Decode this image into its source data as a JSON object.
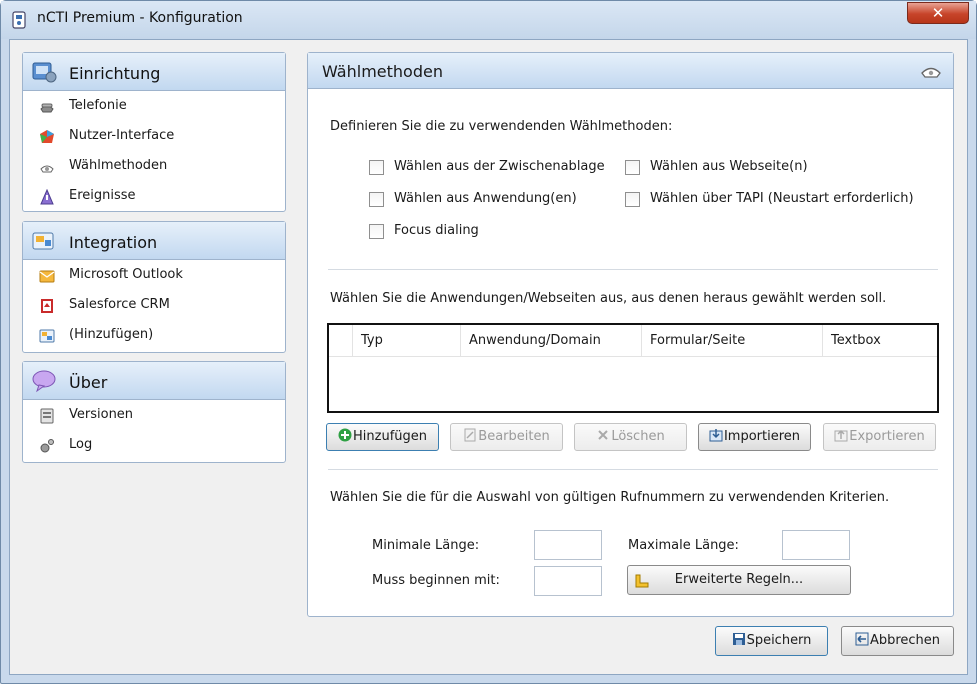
{
  "window": {
    "title": "nCTI Premium - Konfiguration",
    "close_symbol": "✕"
  },
  "sidebar": {
    "groups": [
      {
        "title": "Einrichtung",
        "icon": "setup-icon",
        "items": [
          {
            "label": "Telefonie",
            "icon": "telephone-icon"
          },
          {
            "label": "Nutzer-Interface",
            "icon": "user-interface-icon"
          },
          {
            "label": "Wählmethoden",
            "icon": "dial-methods-icon"
          },
          {
            "label": "Ereignisse",
            "icon": "events-icon"
          }
        ]
      },
      {
        "title": "Integration",
        "icon": "integration-icon",
        "items": [
          {
            "label": "Microsoft Outlook",
            "icon": "outlook-icon"
          },
          {
            "label": "Salesforce CRM",
            "icon": "salesforce-icon"
          },
          {
            "label": "(Hinzufügen)",
            "icon": "add-integration-icon"
          }
        ]
      },
      {
        "title": "Über",
        "icon": "about-icon",
        "items": [
          {
            "label": "Versionen",
            "icon": "versions-icon"
          },
          {
            "label": "Log",
            "icon": "log-icon"
          }
        ]
      }
    ]
  },
  "panel": {
    "title": "Wählmethoden",
    "intro": "Definieren Sie die zu verwendenden Wählmethoden:",
    "checkboxes": [
      {
        "label": "Wählen aus der Zwischenablage",
        "checked": false
      },
      {
        "label": "Wählen aus Webseite(n)",
        "checked": false
      },
      {
        "label": "Wählen aus Anwendung(en)",
        "checked": false
      },
      {
        "label": "Wählen über TAPI (Neustart erforderlich)",
        "checked": false
      },
      {
        "label": "Focus dialing",
        "checked": false
      }
    ],
    "apps_caption": "Wählen Sie die Anwendungen/Webseiten aus, aus denen heraus gewählt werden soll.",
    "table": {
      "columns": [
        "Typ",
        "Anwendung/Domain",
        "Formular/Seite",
        "Textbox"
      ],
      "rows": []
    },
    "buttons": {
      "add": "Hinzufügen",
      "edit": "Bearbeiten",
      "delete": "Löschen",
      "import": "Importieren",
      "export": "Exportieren"
    },
    "criteria_caption": "Wählen Sie die für die Auswahl von gültigen Rufnummern zu verwendenden Kriterien.",
    "min_length_label": "Minimale Länge:",
    "min_length_value": "",
    "max_length_label": "Maximale Länge:",
    "max_length_value": "",
    "prefix_label": "Muss beginnen mit:",
    "prefix_value": "",
    "advanced_rules_label": "Erweiterte Regeln..."
  },
  "footer": {
    "save": "Speichern",
    "cancel": "Abbrechen"
  },
  "colors": {
    "header_gradient_top": "#e6f0fa",
    "header_gradient_bottom": "#c2d8f0",
    "close_button": "#c7442a"
  }
}
